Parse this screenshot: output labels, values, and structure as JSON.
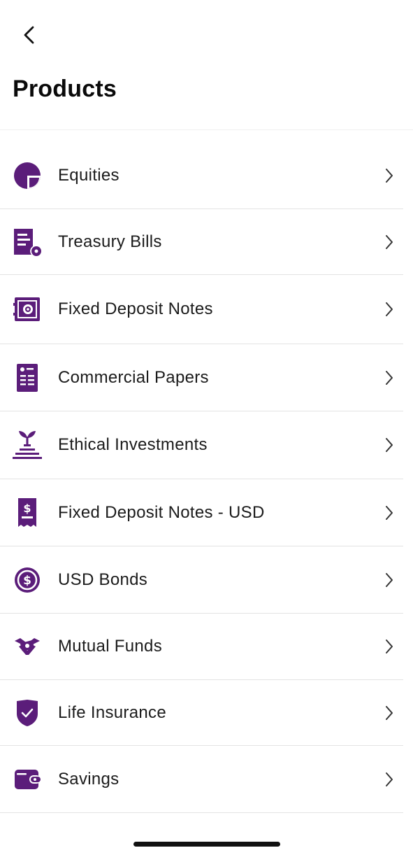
{
  "header": {
    "title": "Products"
  },
  "accent_color": "#5b1d7a",
  "products": [
    {
      "label": "Equities",
      "icon": "pie-chart-icon"
    },
    {
      "label": "Treasury Bills",
      "icon": "document-gear-icon"
    },
    {
      "label": "Fixed Deposit Notes",
      "icon": "safe-icon"
    },
    {
      "label": "Commercial Papers",
      "icon": "id-document-icon"
    },
    {
      "label": "Ethical Investments",
      "icon": "plant-coins-icon"
    },
    {
      "label": "Fixed Deposit Notes - USD",
      "icon": "dollar-receipt-icon"
    },
    {
      "label": "USD Bonds",
      "icon": "dollar-coin-icon"
    },
    {
      "label": "Mutual Funds",
      "icon": "handshake-money-icon"
    },
    {
      "label": "Life Insurance",
      "icon": "shield-check-icon"
    },
    {
      "label": "Savings",
      "icon": "wallet-icon"
    }
  ]
}
